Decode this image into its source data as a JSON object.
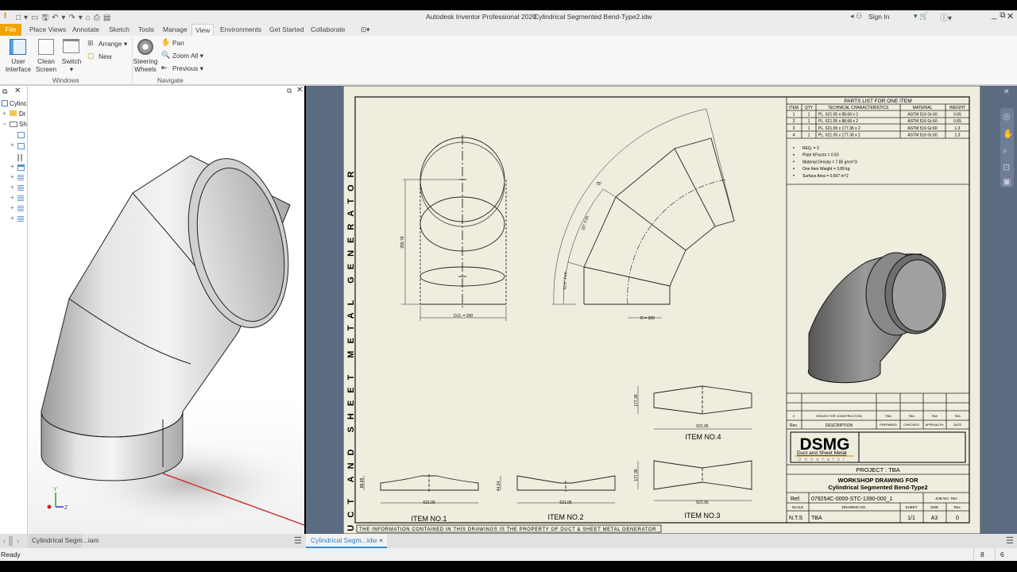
{
  "titlebar": {
    "app_title": "Autodesk Inventor Professional 2020",
    "doc_title": "Cylindrical Segmented Bend-Type2.idw",
    "sign_in": "Sign In"
  },
  "tabs": [
    "File",
    "Place Views",
    "Annotate",
    "Sketch",
    "Tools",
    "Manage",
    "View",
    "Environments",
    "Get Started",
    "Collaborate"
  ],
  "active_tab": "View",
  "ribbon": {
    "user_interface_1": "User",
    "user_interface_2": "Interface",
    "clean_screen_1": "Clean",
    "clean_screen_2": "Screen",
    "switch": "Switch",
    "arrange": "Arrange",
    "new": "New",
    "windows_group": "Windows",
    "steering_1": "Steering",
    "steering_2": "Wheels",
    "pan": "Pan",
    "zoom_all": "Zoom All",
    "previous": "Previous",
    "navigate_group": "Navigate"
  },
  "browser": {
    "items": [
      "Cylinc",
      "Dr",
      "Sh"
    ]
  },
  "sheet": {
    "side_text": "DUCT AND SHEET METAL GENERATOR",
    "footer_note": "THE INFORMATION CONTAINED IN THIS DRAWINGS IS THE PROPERTY OF DUCT & SHEET METAL GENERATOR",
    "dims": {
      "height": "259.78",
      "od": "O.D. = 200",
      "angle_total": "75°",
      "angle_typ": "25° TYP.",
      "angle_half": "12.5° TYP.",
      "radius": "R = 300",
      "flat_len": "621.05",
      "item1_h": "88.68",
      "item2_h": "44.34",
      "item3_h": "177.36",
      "item4_h": "177.36"
    },
    "items": [
      "ITEM NO.1",
      "ITEM NO.2",
      "ITEM NO.3",
      "ITEM NO.4"
    ],
    "parts_list": {
      "title": "PARTS LIST FOR ONE ITEM",
      "headers": [
        "ITEM",
        "QTY",
        "TECHNICAL CHARACTERISTICS",
        "MATERIAL",
        "WEIGHT"
      ],
      "rows": [
        [
          "1",
          "1",
          "PL. 621.05 x 88.68 x 2",
          "ASTM 516 Gr.60",
          "0.65"
        ],
        [
          "2",
          "1",
          "PL. 621.05 x 88.68 x 2",
          "ASTM 516 Gr.60",
          "0.65"
        ],
        [
          "3",
          "1",
          "PL. 621.05 x 177.36 x 2",
          "ASTM 516 Gr.60",
          "1.3"
        ],
        [
          "4",
          "1",
          "PL. 621.05 x 177.36 x 2",
          "ASTM 516 Gr.60",
          "1.3"
        ]
      ],
      "notes": [
        "REQ. = 3",
        "Plate KFactor = 0.50",
        "Material Density = 7.85 g/cm^3",
        "One Item Weight = 3.89 kg",
        "Surface Area = 0.507 m^2"
      ]
    },
    "revision": {
      "row": [
        "0",
        "ISSUED FOR CONSTRUCTION",
        "TBA",
        "TBA",
        "TBA",
        "TBA"
      ],
      "headers": [
        "Rev.",
        "DESCRIPTION",
        "PREPARED",
        "CHECKED",
        "APPR/AUTH",
        "DATE"
      ]
    },
    "logo": {
      "big": "DSMG",
      "line1": "Duct and Sheet Metal",
      "line2": "Generator"
    },
    "project": "PROJECT : TBA",
    "drawing_title_1": "WORKSHOP DRAWING FOR",
    "drawing_title_2": "Cylindrical Segmented Bend-Type2",
    "ref_label": "Ref.",
    "ref_value": "079254C-0000-STC-1390-000_1",
    "job_no": "JOB NO. TBA",
    "info_headers": [
      "SCALE",
      "DRAWING NO.",
      "SHEET",
      "SIZE",
      "Rev."
    ],
    "info_values": [
      "N.T.S",
      "TBA",
      "1/1",
      "A3",
      "0"
    ]
  },
  "bottom": {
    "left_tab": "Cylindrical Segm...iam",
    "right_tab": "Cylindrical Segm...idw",
    "close": "×"
  },
  "status": {
    "text": "Ready",
    "n1": "8",
    "n2": "6"
  },
  "colors": {
    "accent": "#f0a30a",
    "sheet": "#eeedde",
    "background": "#5b6b82",
    "tab_underline": "#2b8fd6"
  }
}
